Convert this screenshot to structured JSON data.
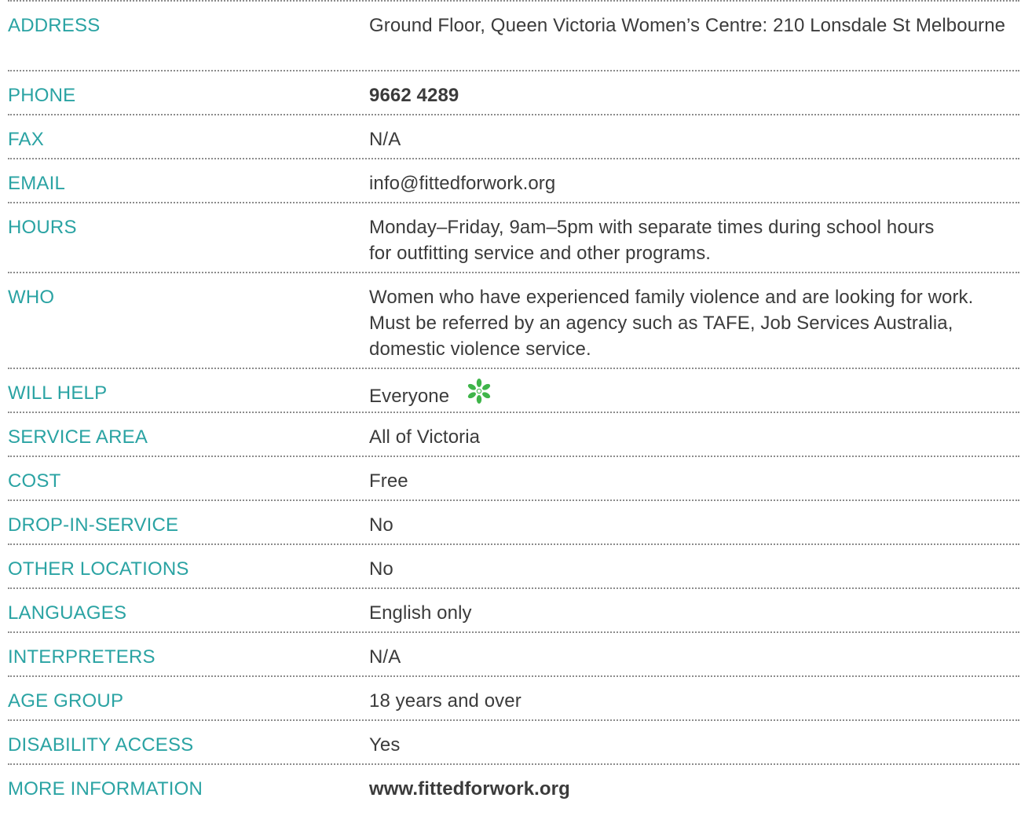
{
  "rows": [
    {
      "label": "ADDRESS",
      "value": "Ground Floor, Queen Victoria Women’s Centre: 210 Lonsdale St Melbourne"
    },
    {
      "label": "PHONE",
      "value": "9662 4289"
    },
    {
      "label": "FAX",
      "value": "N/A"
    },
    {
      "label": "EMAIL",
      "value": "info@fittedforwork.org"
    },
    {
      "label": "HOURS",
      "value": "Monday–Friday, 9am–5pm with separate times during school hours for outfitting service and other programs."
    },
    {
      "label": "WHO",
      "value": "Women who have experienced family violence and are looking for work. Must be referred by an agency such as TAFE, Job Services Australia, domestic violence service."
    },
    {
      "label": "WILL HELP",
      "value": "Everyone",
      "icon": "green-flower-icon"
    },
    {
      "label": "SERVICE AREA",
      "value": "All of Victoria"
    },
    {
      "label": "COST",
      "value": "Free"
    },
    {
      "label": "DROP-IN-SERVICE",
      "value": "No"
    },
    {
      "label": "OTHER LOCATIONS",
      "value": "No"
    },
    {
      "label": "LANGUAGES",
      "value": "English only"
    },
    {
      "label": "INTERPRETERS",
      "value": "N/A"
    },
    {
      "label": "AGE GROUP",
      "value": "18 years and over"
    },
    {
      "label": "DISABILITY ACCESS",
      "value": "Yes"
    },
    {
      "label": "MORE INFORMATION",
      "value": "www.fittedforwork.org"
    }
  ],
  "colors": {
    "label": "#2aa3a3",
    "value": "#3b3b3b",
    "divider": "#8c8c8c",
    "flower": "#3fb54a"
  }
}
